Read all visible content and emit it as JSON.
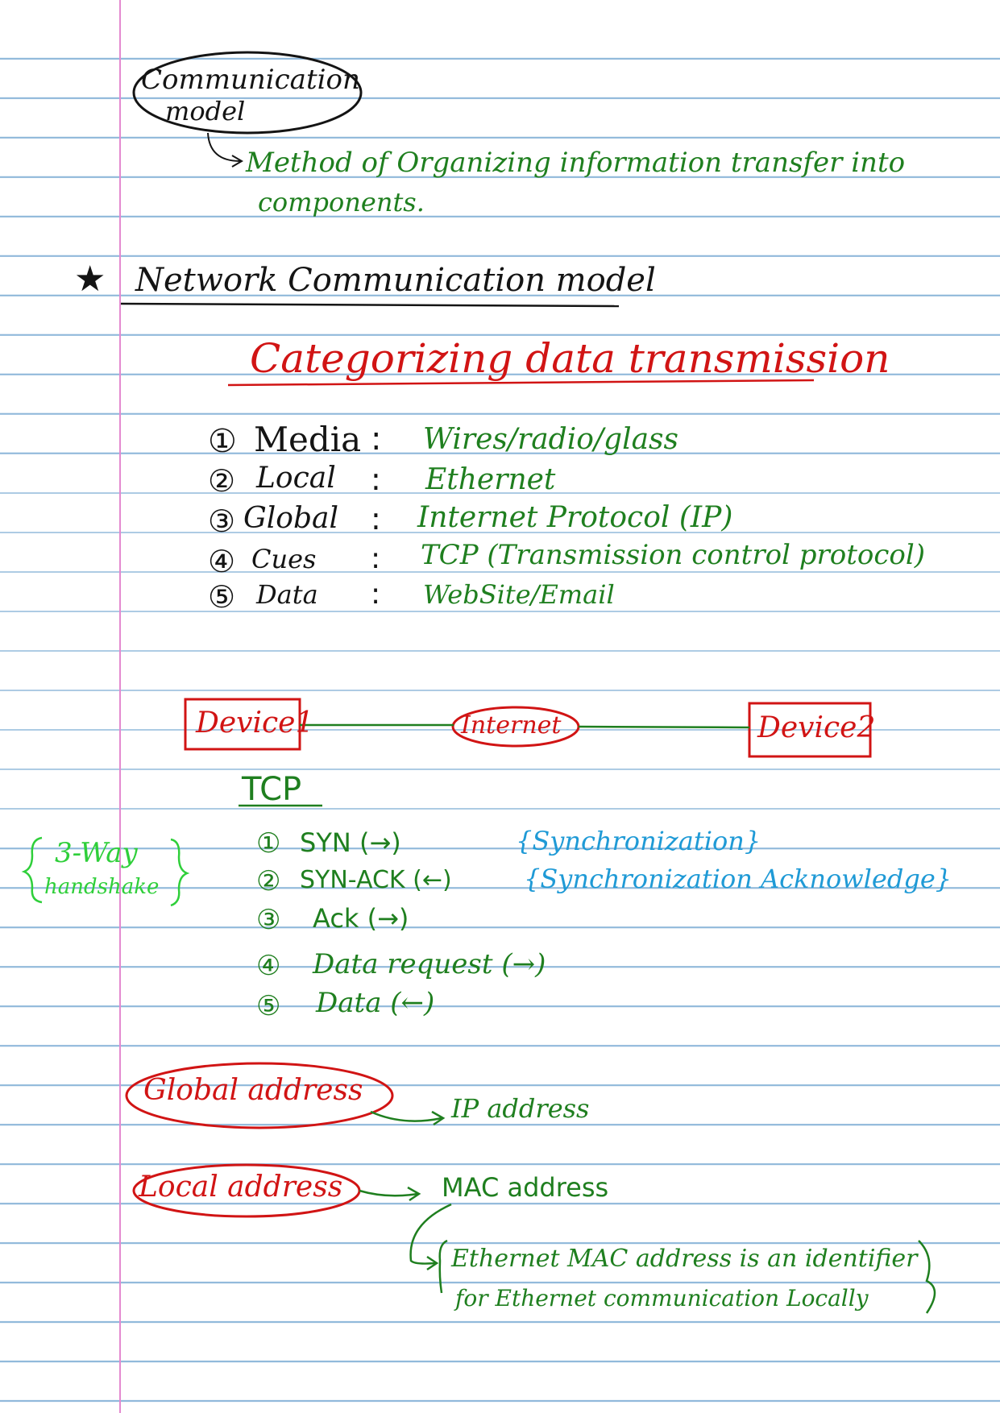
{
  "header": {
    "bubble_line1": "Communication",
    "bubble_line2": "model",
    "definition_line1": "Method of Organizing information transfer into",
    "definition_line2": "components.",
    "star_icon": "star-icon",
    "section_title": "Network Communication model"
  },
  "categorizing": {
    "title": "Categorizing data transmission",
    "items": [
      {
        "num": "①",
        "name": "Media",
        "sep": ":",
        "value": "Wires/radio/glass"
      },
      {
        "num": "②",
        "name": "Local",
        "sep": ":",
        "value": "Ethernet"
      },
      {
        "num": "③",
        "name": "Global",
        "sep": ":",
        "value": "Internet Protocol (IP)"
      },
      {
        "num": "④",
        "name": "Cues",
        "sep": ":",
        "value": "TCP (Transmission control protocol)"
      },
      {
        "num": "⑤",
        "name": "Data",
        "sep": ":",
        "value": "WebSite/Email"
      }
    ]
  },
  "diagram": {
    "device1": "Device1",
    "internet": "Internet",
    "device2": "Device2"
  },
  "tcp": {
    "title": "TCP",
    "handshake_line1": "3-Way",
    "handshake_line2": "handshake",
    "steps": [
      {
        "num": "①",
        "text": "SYN (→)",
        "note": "{Synchronization}"
      },
      {
        "num": "②",
        "text": "SYN-ACK (←)",
        "note": "{Synchronization Acknowledge}"
      },
      {
        "num": "③",
        "text": "Ack (→)",
        "note": ""
      },
      {
        "num": "④",
        "text": "Data request (→)",
        "note": ""
      },
      {
        "num": "⑤",
        "text": "Data (←)",
        "note": ""
      }
    ]
  },
  "addresses": {
    "global_label": "Global address",
    "global_value": "IP address",
    "local_label": "Local address",
    "local_value": "MAC address",
    "local_note_line1": "Ethernet MAC address is an identifier",
    "local_note_line2": "for Ethernet communication Locally"
  },
  "colors": {
    "ink_black": "#141414",
    "ink_green": "#1f7f1f",
    "ink_red": "#d11414",
    "ink_blue": "#1f9ad6",
    "ink_lime": "#2fcf3a",
    "rule_blue": "#8fb8da",
    "margin_pink": "#e48ad0"
  }
}
